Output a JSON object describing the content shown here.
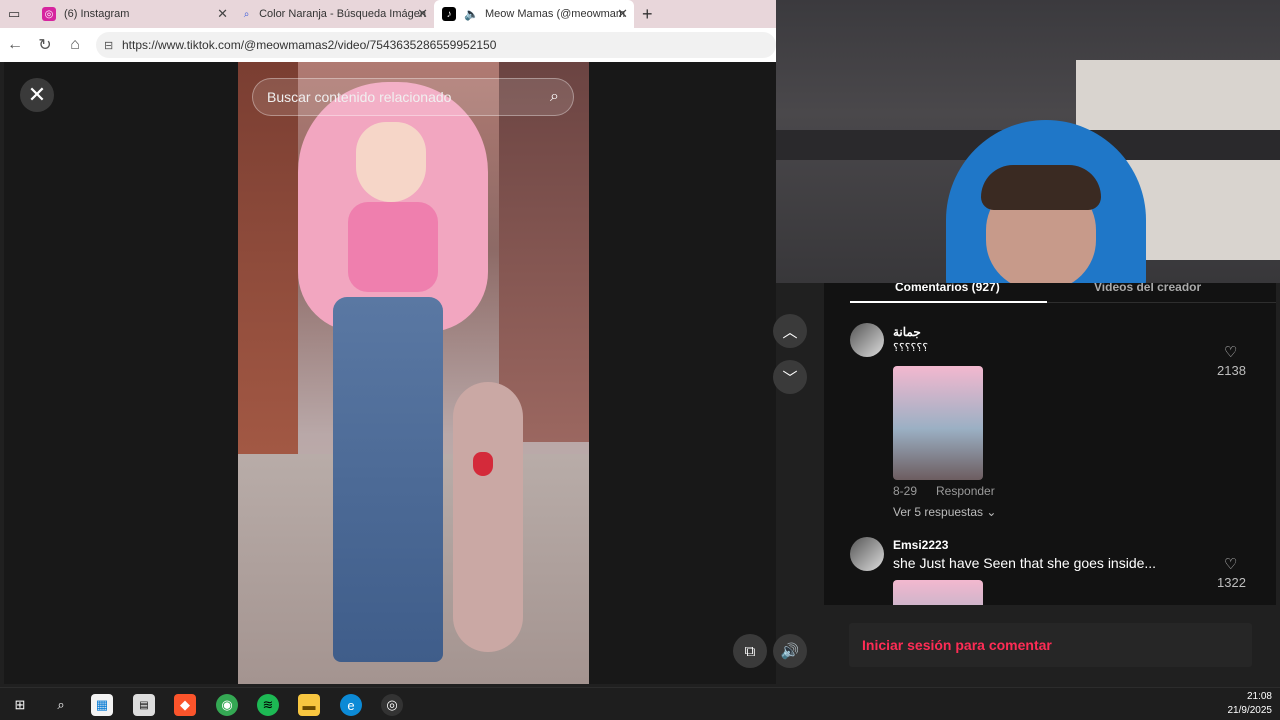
{
  "tabs": [
    {
      "label": "(6) Instagram",
      "icon": "instagram-icon",
      "color": "#d6249f"
    },
    {
      "label": "Color Naranja - Búsqueda Imágen",
      "icon": "search-icon",
      "color": "#3b5bdb"
    },
    {
      "label": "Meow Mamas (@meowmam",
      "icon": "tiktok-icon",
      "color": "#000000"
    }
  ],
  "address": {
    "url": "https://www.tiktok.com/@meowmamas2/video/7543635286559952150"
  },
  "viewer": {
    "search_placeholder": "Buscar contenido relacionado"
  },
  "comments_panel": {
    "tab_comments": "Comentarios (927)",
    "tab_creator": "Videos del creador",
    "items": [
      {
        "user": "جمانة",
        "text": "؟؟؟؟؟؟",
        "date": "8-29",
        "reply": "Responder",
        "replies": "Ver 5 respuestas ⌄",
        "likes": "2138"
      },
      {
        "user": "Emsi2223",
        "text": "she Just have Seen that she goes inside...",
        "likes": "1322"
      }
    ],
    "login_label": "Iniciar sesión para comentar"
  },
  "taskbar": {
    "time": "21:08",
    "date": "21/9/2025"
  },
  "colors": {
    "accent": "#fe2c55",
    "panel": "#121212"
  }
}
